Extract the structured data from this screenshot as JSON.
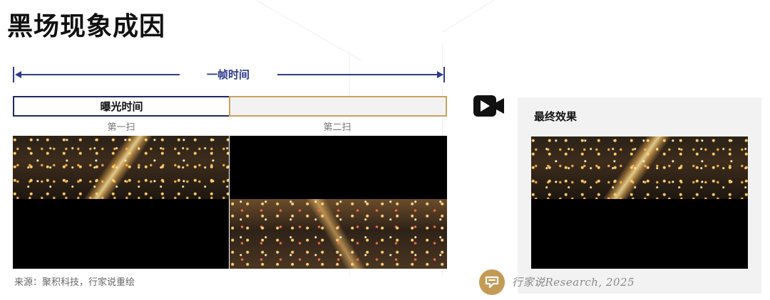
{
  "title": "黑场现象成因",
  "frame": {
    "label": "一帧时间"
  },
  "exposure": {
    "label": "曝光时间"
  },
  "scans": {
    "first": "第一扫",
    "second": "第二扫"
  },
  "result": {
    "title": "最终效果"
  },
  "source": "来源：聚积科技，行家说重绘",
  "credit": "行家说Research, 2025",
  "icons": {
    "camera": "video-camera-icon",
    "logo": "brand-logo-icon"
  },
  "colors": {
    "arrow": "#2d3a8c",
    "accent": "#c9a15a",
    "logo": "#c49a55"
  }
}
